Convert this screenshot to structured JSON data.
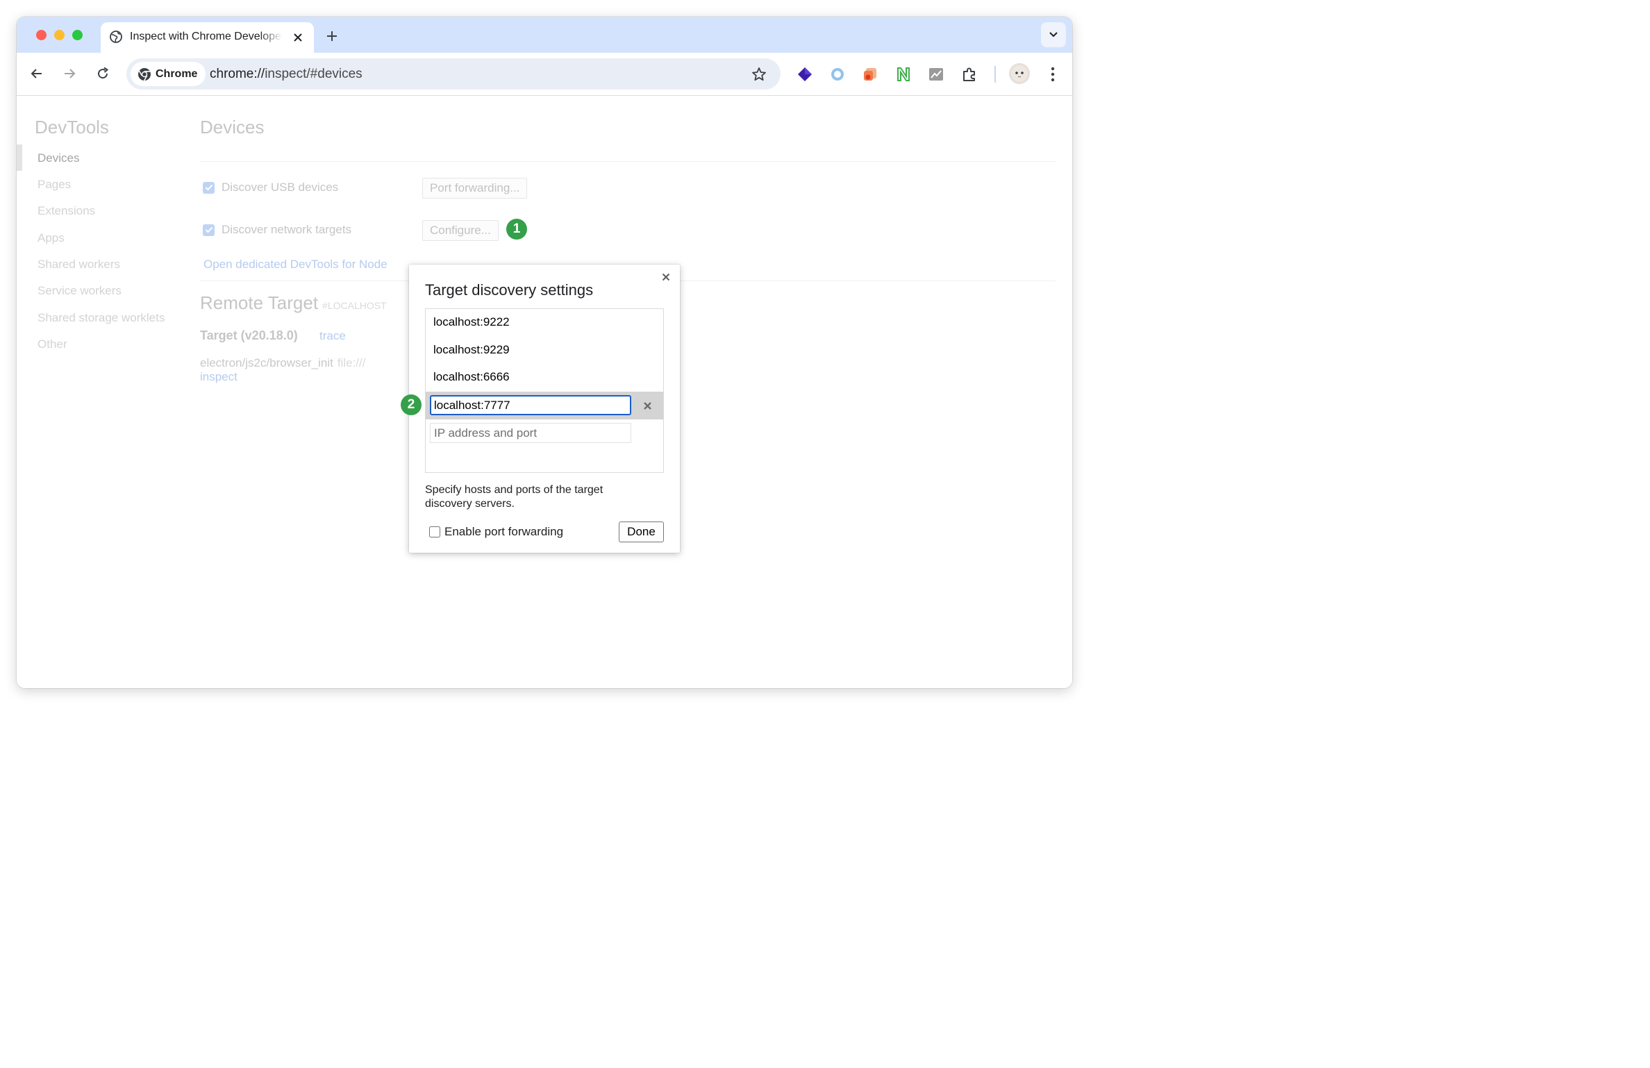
{
  "browser": {
    "tab": {
      "title": "Inspect with Chrome Developer Tools",
      "close_icon": "close-icon"
    },
    "new_tab_icon": "plus-icon",
    "tab_search_icon": "chevron-down-icon",
    "omnibox": {
      "chip_label": "Chrome",
      "url_scheme": "chrome://",
      "url_path": "inspect/#devices"
    },
    "extensions": [
      "obsidian-icon",
      "circle-ring-icon",
      "stack-icon",
      "n-logo-icon",
      "chart-icon",
      "puzzle-icon"
    ],
    "colors": {
      "tabstrip": "#d3e3fd",
      "omnibox": "#e9eef6"
    }
  },
  "sidebar": {
    "title": "DevTools",
    "items": [
      {
        "label": "Devices"
      },
      {
        "label": "Pages"
      },
      {
        "label": "Extensions"
      },
      {
        "label": "Apps"
      },
      {
        "label": "Shared workers"
      },
      {
        "label": "Service workers"
      },
      {
        "label": "Shared storage worklets"
      },
      {
        "label": "Other"
      }
    ],
    "selected": "Devices"
  },
  "main": {
    "title": "Devices",
    "discover_usb": {
      "label": "Discover USB devices",
      "checked": true,
      "button": "Port forwarding..."
    },
    "discover_network": {
      "label": "Discover network targets",
      "checked": true,
      "button": "Configure..."
    },
    "node_link": "Open dedicated DevTools for Node",
    "remote": {
      "title": "Remote Target",
      "subtitle": "#LOCALHOST",
      "target_name": "Target (v20.18.0)",
      "trace_link": "trace",
      "path": "electron/js2c/browser_init",
      "url": "file:///",
      "inspect_link": "inspect"
    }
  },
  "badges": {
    "configure": "1",
    "editing": "2",
    "color": "#34a04a"
  },
  "dialog": {
    "title": "Target discovery settings",
    "hosts": [
      "localhost:9222",
      "localhost:9229",
      "localhost:6666"
    ],
    "editing_value": "localhost:7777",
    "new_placeholder": "IP address and port",
    "help": "Specify hosts and ports of the target discovery servers.",
    "port_forwarding_label": "Enable port forwarding",
    "port_forwarding_checked": false,
    "done_label": "Done"
  }
}
